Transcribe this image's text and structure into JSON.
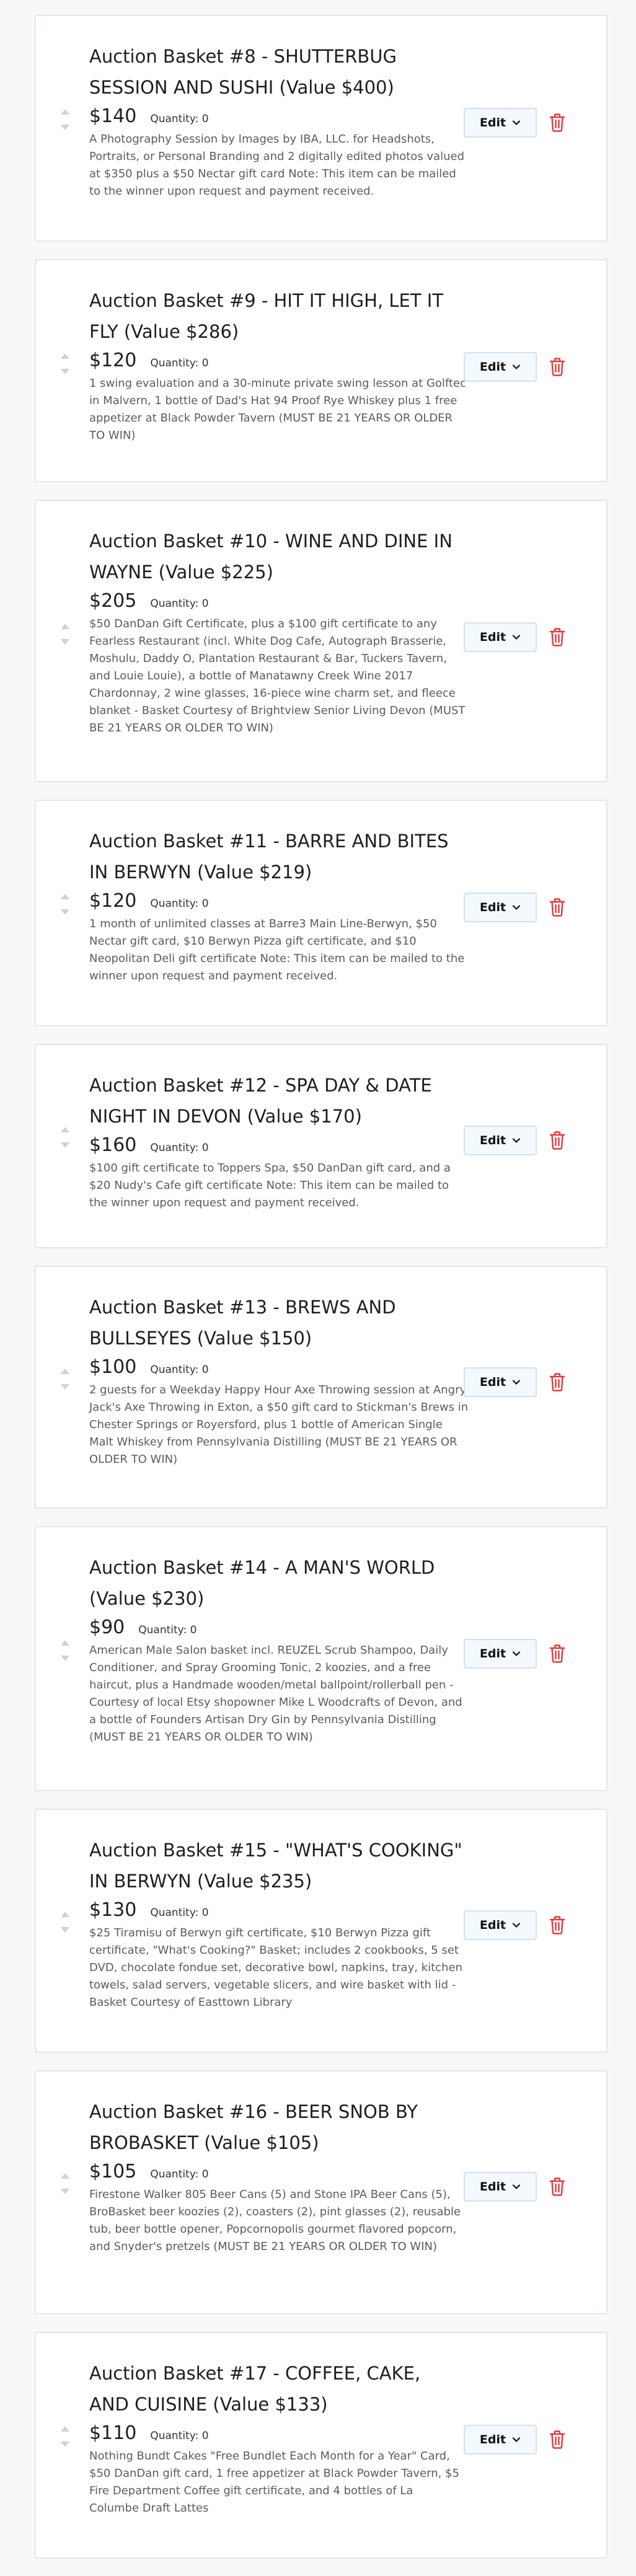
{
  "colors": {
    "trash": "#e4393c",
    "edit_border": "#cfe1f3",
    "edit_background": "#f4f9fe",
    "card_border": "#e3e6ea",
    "sort_arrow": "#cfd3d8"
  },
  "icons": {
    "sort_up": "sort-up-icon",
    "sort_down": "sort-down-icon",
    "edit_dropdown": "chevron-down-icon",
    "delete": "trash-icon"
  },
  "items": [
    {
      "title": "Auction Basket #8 - SHUTTERBUG SESSION AND SUSHI (Value $400)",
      "price": "$140",
      "quantity": "Quantity: 0",
      "description": "A Photography Session by Images by IBA, LLC. for Headshots, Portraits, or Personal Branding and 2 digitally edited photos valued at $350 plus a $50 Nectar gift card Note: This item can be mailed to the winner upon request and payment received.",
      "edit_label": "Edit"
    },
    {
      "title": "Auction Basket #9 - HIT IT HIGH, LET IT FLY (Value $286)",
      "price": "$120",
      "quantity": "Quantity: 0",
      "description": "1 swing evaluation and a 30-minute private swing lesson at Golftec in Malvern, 1 bottle of Dad's Hat 94 Proof Rye Whiskey plus 1 free appetizer at Black Powder Tavern (MUST BE 21 YEARS OR OLDER TO WIN)",
      "edit_label": "Edit"
    },
    {
      "title": "Auction Basket #10 - WINE AND DINE IN WAYNE (Value $225)",
      "price": "$205",
      "quantity": "Quantity: 0",
      "description": "$50 DanDan Gift Certificate, plus a $100 gift certificate to any Fearless Restaurant (incl. White Dog Cafe, Autograph Brasserie, Moshulu, Daddy O, Plantation Restaurant & Bar, Tuckers Tavern, and Louie Louie), a bottle of Manatawny Creek Wine 2017 Chardonnay, 2 wine glasses, 16-piece wine charm set, and fleece blanket - Basket Courtesy of Brightview Senior Living Devon (MUST BE 21 YEARS OR OLDER TO WIN)",
      "edit_label": "Edit"
    },
    {
      "title": "Auction Basket #11 - BARRE AND BITES IN BERWYN (Value $219)",
      "price": "$120",
      "quantity": "Quantity: 0",
      "description": "1 month of unlimited classes at Barre3 Main Line-Berwyn, $50 Nectar gift card, $10 Berwyn Pizza gift certificate, and $10 Neopolitan Deli gift certificate Note: This item can be mailed to the winner upon request and payment received.",
      "edit_label": "Edit"
    },
    {
      "title": "Auction Basket #12 - SPA DAY & DATE NIGHT IN DEVON (Value $170)",
      "price": "$160",
      "quantity": "Quantity: 0",
      "description": "$100 gift certificate to Toppers Spa, $50 DanDan gift card, and a $20 Nudy's Cafe gift certificate Note: This item can be mailed to the winner upon request and payment received.",
      "edit_label": "Edit"
    },
    {
      "title": "Auction Basket #13 - BREWS AND BULLSEYES (Value $150)",
      "price": "$100",
      "quantity": "Quantity: 0",
      "description": "2 guests for a Weekday Happy Hour Axe Throwing session at Angry Jack's Axe Throwing in Exton, a $50 gift card to Stickman's Brews in Chester Springs or Royersford, plus 1 bottle of American Single Malt Whiskey from Pennsylvania Distilling (MUST BE 21 YEARS OR OLDER TO WIN)",
      "edit_label": "Edit"
    },
    {
      "title": "Auction Basket #14 - A MAN'S WORLD (Value $230)",
      "price": "$90",
      "quantity": "Quantity: 0",
      "description": "American Male Salon basket incl. REUZEL Scrub Shampoo, Daily Conditioner, and Spray Grooming Tonic, 2 koozies, and a free haircut, plus a Handmade wooden/metal ballpoint/rollerball pen - Courtesy of local Etsy shopowner Mike L Woodcrafts of Devon, and a bottle of Founders Artisan Dry Gin by Pennsylvania Distilling (MUST BE 21 YEARS OR OLDER TO WIN)",
      "edit_label": "Edit"
    },
    {
      "title": "Auction Basket #15 - \"WHAT'S COOKING\" IN BERWYN (Value $235)",
      "price": "$130",
      "quantity": "Quantity: 0",
      "description": "$25 Tiramisu of Berwyn gift certificate, $10 Berwyn Pizza gift certificate, \"What's Cooking?\" Basket; includes 2 cookbooks, 5 set DVD, chocolate fondue set, decorative bowl, napkins, tray, kitchen towels, salad servers, vegetable slicers, and wire basket with lid - Basket Courtesy of Easttown Library",
      "edit_label": "Edit"
    },
    {
      "title": "Auction Basket #16 - BEER SNOB BY BROBASKET (Value $105)",
      "price": "$105",
      "quantity": "Quantity: 0",
      "description": "Firestone Walker 805 Beer Cans (5) and Stone IPA Beer Cans (5), BroBasket beer koozies (2), coasters (2), pint glasses (2), reusable tub, beer bottle opener, Popcornopolis gourmet flavored popcorn, and Snyder's pretzels (MUST BE 21 YEARS OR OLDER TO WIN)",
      "edit_label": "Edit"
    },
    {
      "title": "Auction Basket #17 - COFFEE, CAKE, AND CUISINE (Value $133)",
      "price": "$110",
      "quantity": "Quantity: 0",
      "description": "Nothing Bundt Cakes \"Free Bundlet Each Month for a Year\" Card, $50 DanDan gift card, 1 free appetizer at Black Powder Tavern, $5 Fire Department Coffee gift certificate, and 4 bottles of La Columbe Draft Lattes",
      "edit_label": "Edit"
    }
  ]
}
